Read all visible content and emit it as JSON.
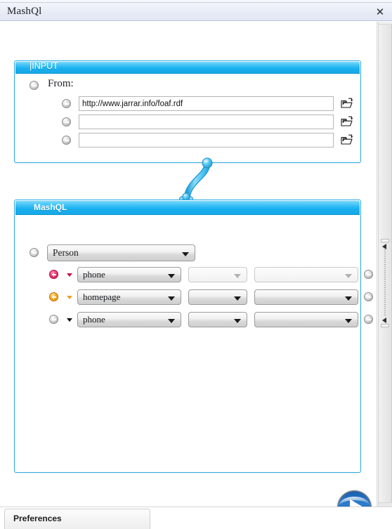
{
  "window": {
    "title": "MashQl",
    "close_label": "✕"
  },
  "input_panel": {
    "header_title": "|INPUT",
    "from_label": "From:",
    "add_icon": "plus-circle-icon",
    "rows": [
      {
        "remove_icon": "minus-circle-icon",
        "value": "http://www.jarrar.info/foaf.rdf",
        "placeholder": "",
        "browse_icon": "open-folder-icon"
      },
      {
        "remove_icon": "minus-circle-icon",
        "value": "",
        "placeholder": "",
        "browse_icon": "open-folder-icon"
      },
      {
        "remove_icon": "minus-circle-icon",
        "value": "",
        "placeholder": "",
        "browse_icon": "open-folder-icon"
      }
    ]
  },
  "connector": {
    "icon": "s-curve-pipe-connector",
    "color": "#2fb6ec"
  },
  "mashql_panel": {
    "header_title": "MashQL",
    "add_icon": "plus-circle-icon",
    "subject": {
      "value": "Person",
      "arrow_icon": "chevron-down-icon"
    },
    "rows": [
      {
        "add_icon": "plus-circle-icon",
        "add_color": "#cf0f47",
        "sort_arrow_icon": "caret-down-icon",
        "sort_color": "#cf1045",
        "predicate": "phone",
        "operator": "",
        "object": "",
        "predicate_enabled": true,
        "operator_enabled": false,
        "object_enabled": false,
        "remove_icon": "minus-circle-icon"
      },
      {
        "add_icon": "plus-circle-icon",
        "add_color": "#e28907",
        "sort_arrow_icon": "caret-down-icon",
        "sort_color": "#f0a01e",
        "predicate": "homepage",
        "operator": "",
        "object": "",
        "predicate_enabled": true,
        "operator_enabled": true,
        "object_enabled": true,
        "remove_icon": "minus-circle-icon"
      },
      {
        "add_icon": "plus-circle-icon",
        "add_color": "#9d9d9d",
        "sort_arrow_icon": "caret-down-icon",
        "sort_color": "#111111",
        "predicate": "phone",
        "operator": "",
        "object": "",
        "predicate_enabled": true,
        "operator_enabled": true,
        "object_enabled": true,
        "remove_icon": "minus-circle-icon"
      }
    ]
  },
  "run_button": {
    "icon": "play-button-icon",
    "color": "#1f6fc4"
  },
  "tabs": [
    {
      "label": "Preferences"
    }
  ],
  "divider": {
    "up_icon": "collapse-left-arrow-icon",
    "down_icon": "collapse-left-arrow-icon",
    "grip_icon": "drag-grip-icon"
  },
  "colors": {
    "panel_border": "#2aa9e0",
    "panel_header": "#19b0ef",
    "titlebar": "#e8ecf6"
  }
}
